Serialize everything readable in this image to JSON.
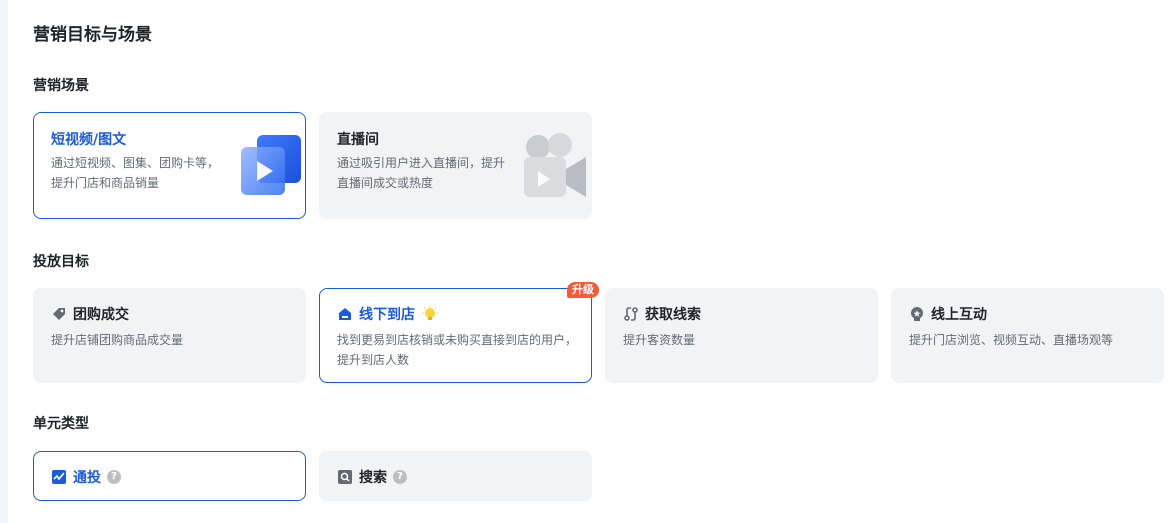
{
  "page": {
    "title": "营销目标与场景"
  },
  "scene_section": {
    "title": "营销场景",
    "cards": [
      {
        "title": "短视频/图文",
        "desc": "通过短视频、图集、团购卡等，提升门店和商品销量",
        "selected": true
      },
      {
        "title": "直播间",
        "desc": "通过吸引用户进入直播间，提升直播间成交或热度",
        "selected": false
      }
    ]
  },
  "goal_section": {
    "title": "投放目标",
    "cards": [
      {
        "title": "团购成交",
        "desc": "提升店铺团购商品成交量",
        "icon": "tag-icon",
        "selected": false
      },
      {
        "title": "线下到店",
        "desc": "找到更易到店核销或未购买直接到店的用户，提升到店人数",
        "icon": "store-icon",
        "badge": "升级",
        "selected": true
      },
      {
        "title": "获取线索",
        "desc": "提升客资数量",
        "icon": "route-icon",
        "selected": false
      },
      {
        "title": "线上互动",
        "desc": "提升门店浏览、视频互动、直播场观等",
        "icon": "medal-icon",
        "selected": false
      }
    ]
  },
  "type_section": {
    "title": "单元类型",
    "cards": [
      {
        "title": "通投",
        "icon": "chart-icon",
        "selected": true
      },
      {
        "title": "搜索",
        "icon": "search-icon",
        "selected": false
      }
    ]
  },
  "colors": {
    "accent": "#1d5cd8",
    "card_bg": "#f2f3f5",
    "badge": "#f35b3a"
  }
}
